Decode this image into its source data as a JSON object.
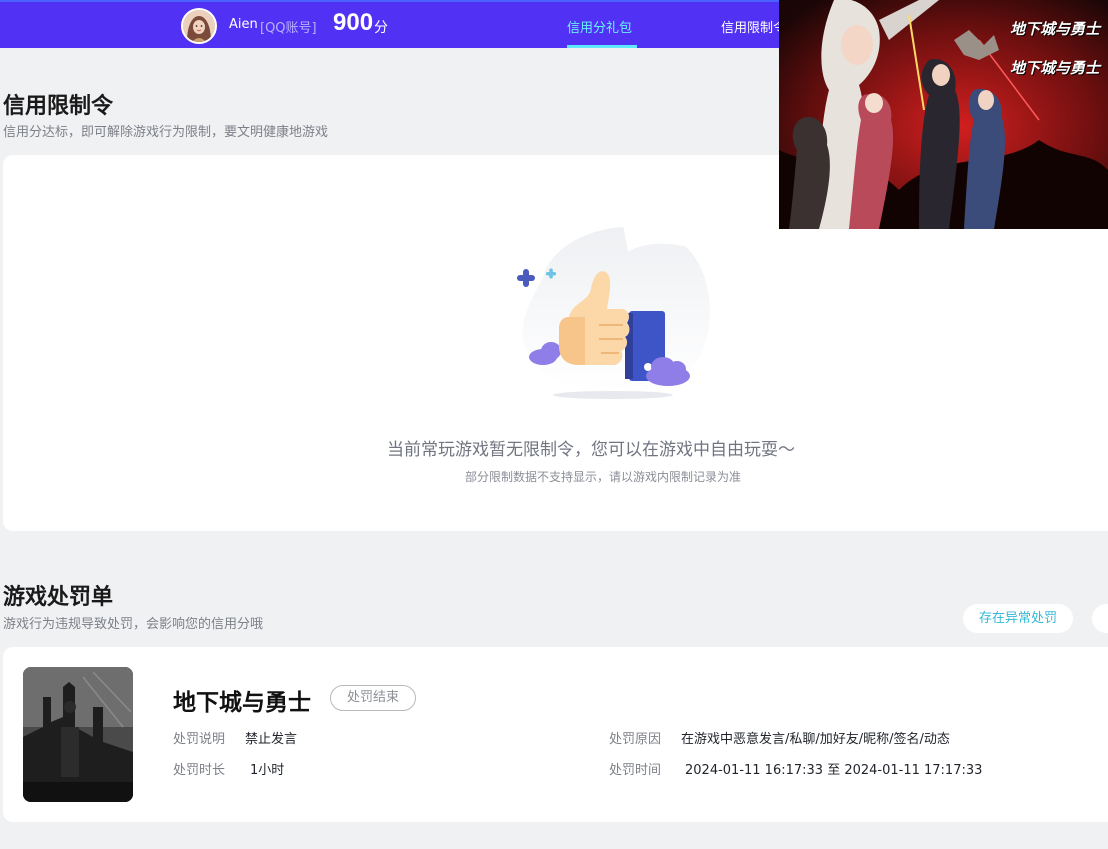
{
  "header": {
    "user_name": "Aien",
    "account_type": "[QQ账号]",
    "score": "900",
    "score_unit": "分",
    "tabs": [
      {
        "label": "信用分礼包",
        "active": true
      },
      {
        "label": "信用限制令",
        "active": false
      }
    ]
  },
  "restriction": {
    "title": "信用限制令",
    "subtitle": "信用分达标，即可解除游戏行为限制，要文明健康地游戏",
    "empty_message": "当前常玩游戏暂无限制令，您可以在游戏中自由玩耍～",
    "empty_note": "部分限制数据不支持显示，请以游戏内限制记录为准"
  },
  "penalty": {
    "title": "游戏处罚单",
    "subtitle": "游戏行为违规导致处罚，会影响您的信用分哦",
    "filter_button": "存在异常处罚",
    "record": {
      "game_name": "地下城与勇士",
      "status": "处罚结束",
      "desc_label": "处罚说明",
      "desc_value": "禁止发言",
      "duration_label": "处罚时长",
      "duration_value": "1小时",
      "reason_label": "处罚原因",
      "reason_value": "在游戏中恶意发言/私聊/加好友/昵称/签名/动态",
      "time_label": "处罚时间",
      "time_value": "2024-01-11 16:17:33 至 2024-01-11 17:17:33"
    }
  },
  "overlay": {
    "logo_lines": [
      "地下城与勇士",
      "地下城与勇士"
    ]
  },
  "colors": {
    "nav_bg": "#5132f5",
    "nav_active": "#6cf0ff",
    "accent_teal": "#33b8d6",
    "page_bg": "#f0f1f3"
  }
}
